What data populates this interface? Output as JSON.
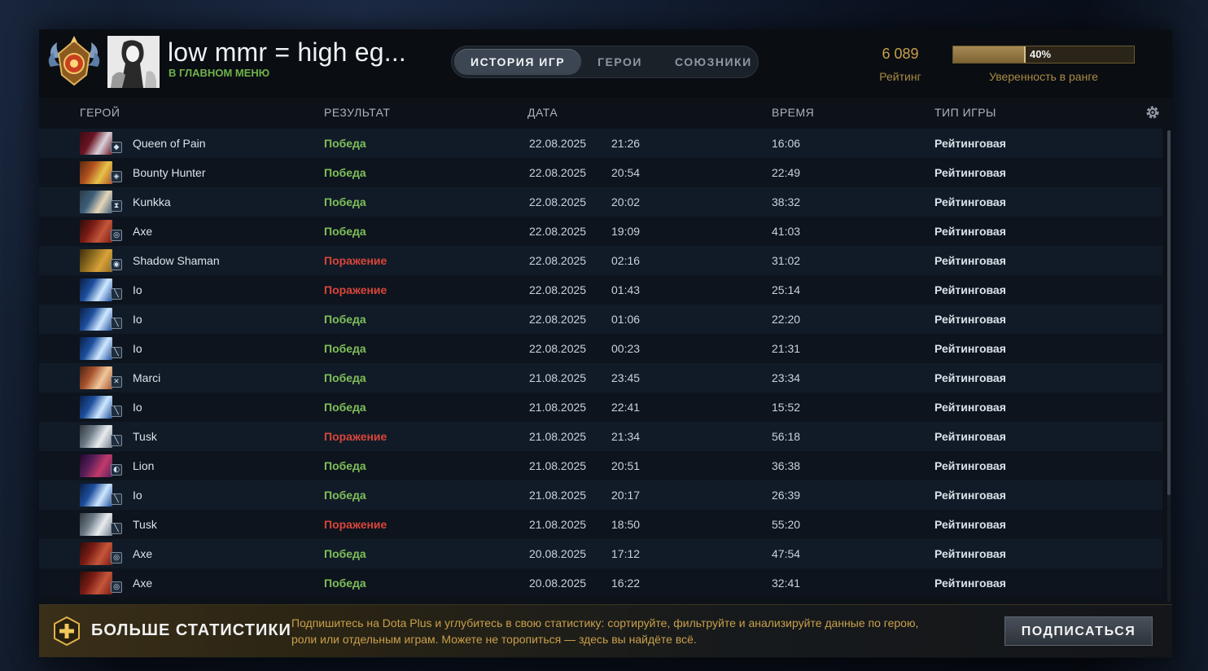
{
  "header": {
    "player_name": "low mmr = high eg...",
    "player_status": "В ГЛАВНОМ МЕНЮ",
    "tabs": [
      {
        "label": "ИСТОРИЯ ИГР",
        "active": true
      },
      {
        "label": "ГЕРОИ",
        "active": false
      },
      {
        "label": "СОЮЗНИКИ",
        "active": false
      }
    ],
    "rating_value": "6 089",
    "rating_label": "Рейтинг",
    "confidence_text": "40%",
    "confidence_fraction": 0.4,
    "confidence_label": "Уверенность в ранге"
  },
  "columns": {
    "hero": "ГЕРОЙ",
    "result": "РЕЗУЛЬТАТ",
    "date": "ДАТА",
    "duration": "ВРЕМЯ",
    "game_type": "ТИП ИГРЫ"
  },
  "colors": {
    "win": "#7fbf5a",
    "loss": "#d8453a",
    "gold": "#c9a04a"
  },
  "matches": [
    {
      "hero": "Queen of Pain",
      "icon": "queen-of-pain-portrait",
      "result": "Победа",
      "win": true,
      "date": "22.08.2025",
      "time": "21:26",
      "duration": "16:06",
      "type": "Рейтинговая"
    },
    {
      "hero": "Bounty Hunter",
      "icon": "bounty-hunter-portrait",
      "result": "Победа",
      "win": true,
      "date": "22.08.2025",
      "time": "20:54",
      "duration": "22:49",
      "type": "Рейтинговая"
    },
    {
      "hero": "Kunkka",
      "icon": "kunkka-portrait",
      "result": "Победа",
      "win": true,
      "date": "22.08.2025",
      "time": "20:02",
      "duration": "38:32",
      "type": "Рейтинговая"
    },
    {
      "hero": "Axe",
      "icon": "axe-portrait",
      "result": "Победа",
      "win": true,
      "date": "22.08.2025",
      "time": "19:09",
      "duration": "41:03",
      "type": "Рейтинговая"
    },
    {
      "hero": "Shadow Shaman",
      "icon": "shadow-shaman-portrait",
      "result": "Поражение",
      "win": false,
      "date": "22.08.2025",
      "time": "02:16",
      "duration": "31:02",
      "type": "Рейтинговая"
    },
    {
      "hero": "Io",
      "icon": "io-portrait",
      "result": "Поражение",
      "win": false,
      "date": "22.08.2025",
      "time": "01:43",
      "duration": "25:14",
      "type": "Рейтинговая"
    },
    {
      "hero": "Io",
      "icon": "io-portrait",
      "result": "Победа",
      "win": true,
      "date": "22.08.2025",
      "time": "01:06",
      "duration": "22:20",
      "type": "Рейтинговая"
    },
    {
      "hero": "Io",
      "icon": "io-portrait",
      "result": "Победа",
      "win": true,
      "date": "22.08.2025",
      "time": "00:23",
      "duration": "21:31",
      "type": "Рейтинговая"
    },
    {
      "hero": "Marci",
      "icon": "marci-portrait",
      "result": "Победа",
      "win": true,
      "date": "21.08.2025",
      "time": "23:45",
      "duration": "23:34",
      "type": "Рейтинговая"
    },
    {
      "hero": "Io",
      "icon": "io-portrait",
      "result": "Победа",
      "win": true,
      "date": "21.08.2025",
      "time": "22:41",
      "duration": "15:52",
      "type": "Рейтинговая"
    },
    {
      "hero": "Tusk",
      "icon": "tusk-portrait",
      "result": "Поражение",
      "win": false,
      "date": "21.08.2025",
      "time": "21:34",
      "duration": "56:18",
      "type": "Рейтинговая"
    },
    {
      "hero": "Lion",
      "icon": "lion-portrait",
      "result": "Победа",
      "win": true,
      "date": "21.08.2025",
      "time": "20:51",
      "duration": "36:38",
      "type": "Рейтинговая"
    },
    {
      "hero": "Io",
      "icon": "io-portrait",
      "result": "Победа",
      "win": true,
      "date": "21.08.2025",
      "time": "20:17",
      "duration": "26:39",
      "type": "Рейтинговая"
    },
    {
      "hero": "Tusk",
      "icon": "tusk-portrait",
      "result": "Поражение",
      "win": false,
      "date": "21.08.2025",
      "time": "18:50",
      "duration": "55:20",
      "type": "Рейтинговая"
    },
    {
      "hero": "Axe",
      "icon": "axe-portrait",
      "result": "Победа",
      "win": true,
      "date": "20.08.2025",
      "time": "17:12",
      "duration": "47:54",
      "type": "Рейтинговая"
    },
    {
      "hero": "Axe",
      "icon": "axe-portrait",
      "result": "Победа",
      "win": true,
      "date": "20.08.2025",
      "time": "16:22",
      "duration": "32:41",
      "type": "Рейтинговая"
    }
  ],
  "banner": {
    "title": "БОЛЬШЕ СТАТИСТИКИ",
    "text": "Подпишитесь на Dota Plus и углубитесь в свою статистику: сортируйте, фильтруйте и анализируйте данные по герою, роли или отдельным играм. Можете не торопиться — здесь вы найдёте всё.",
    "button": "ПОДПИСАТЬСЯ"
  }
}
